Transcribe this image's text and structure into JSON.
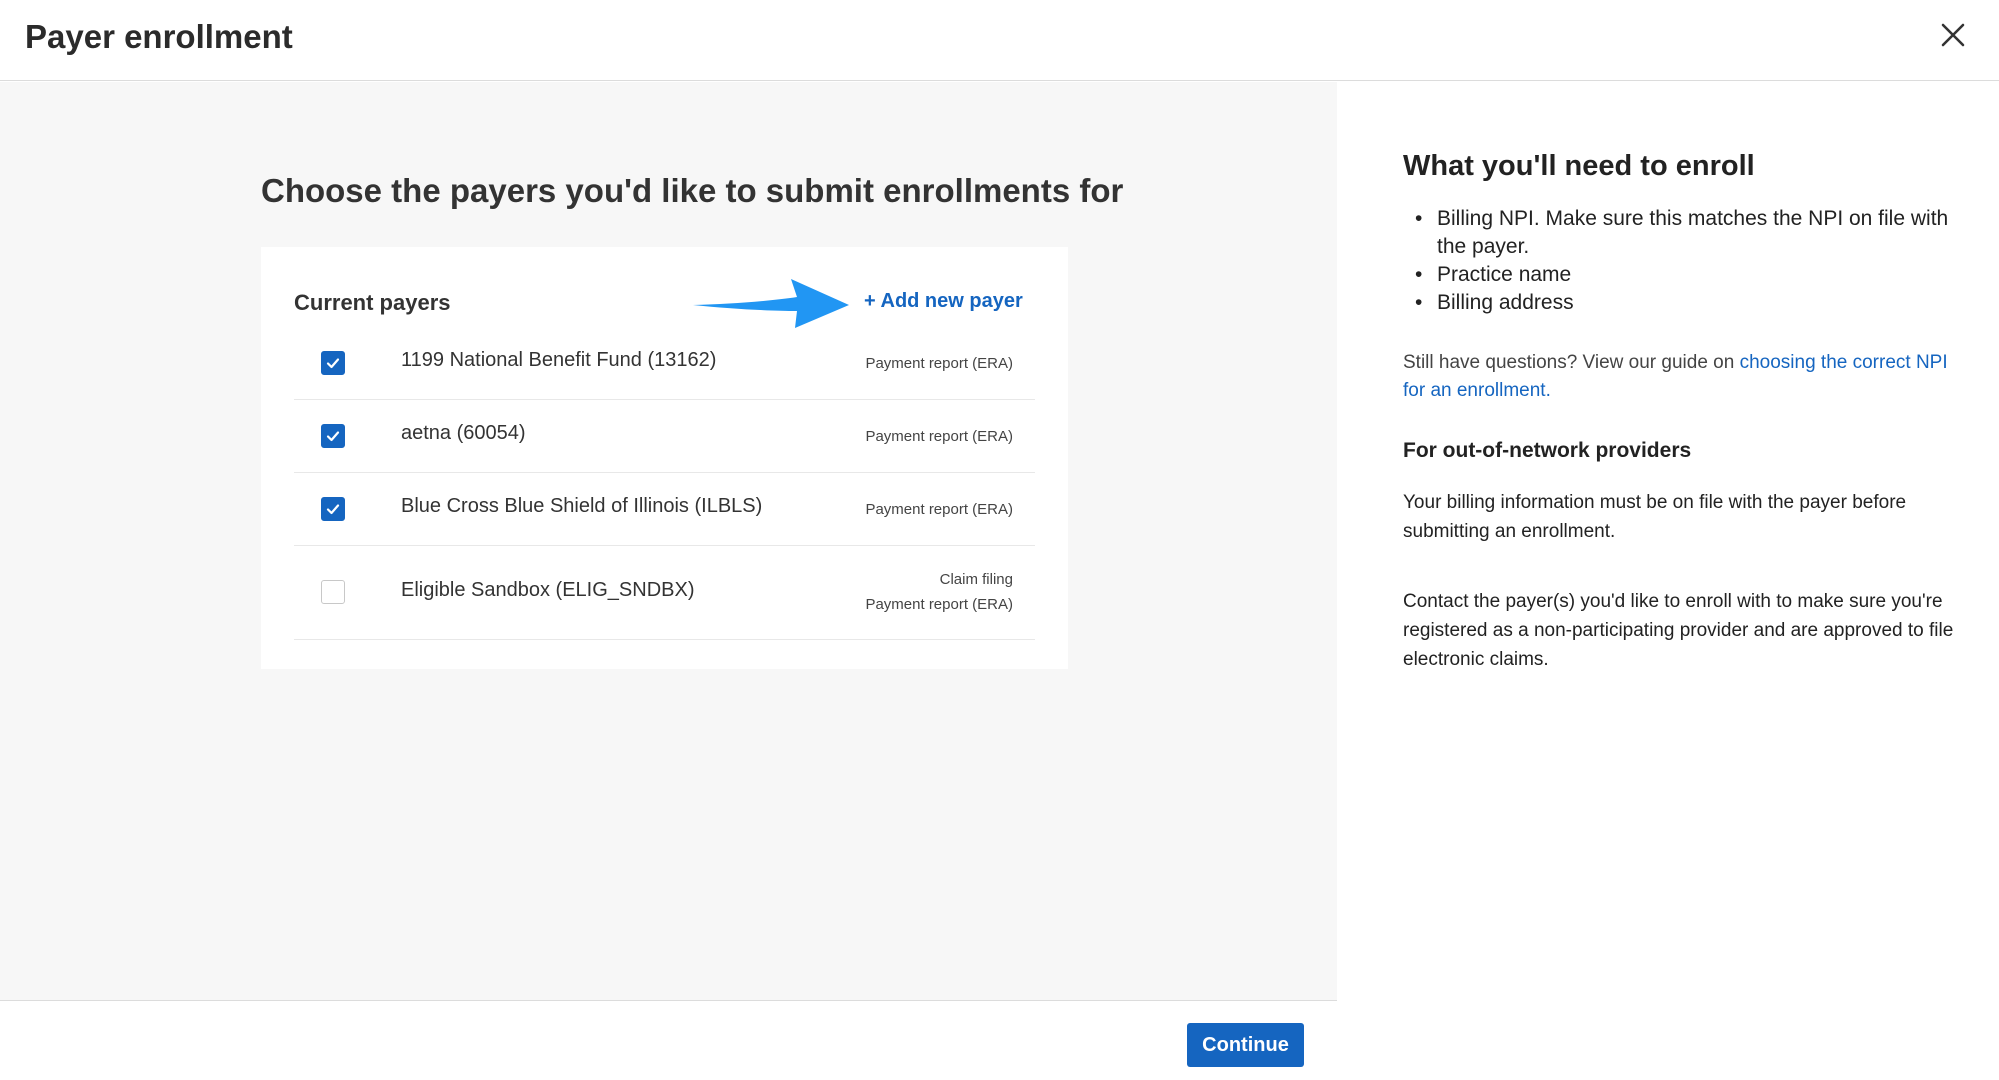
{
  "header": {
    "title": "Payer enrollment"
  },
  "main": {
    "heading": "Choose the payers you'd like to submit enrollments for",
    "card": {
      "title": "Current payers",
      "add_link": "+ Add new payer",
      "payers": [
        {
          "name": "1199 National Benefit Fund (13162)",
          "checked": true,
          "services": [
            "Payment report (ERA)"
          ]
        },
        {
          "name": "aetna (60054)",
          "checked": true,
          "services": [
            "Payment report (ERA)"
          ]
        },
        {
          "name": "Blue Cross Blue Shield of Illinois (ILBLS)",
          "checked": true,
          "services": [
            "Payment report (ERA)"
          ]
        },
        {
          "name": "Eligible Sandbox (ELIG_SNDBX)",
          "checked": false,
          "services": [
            "Claim filing",
            "Payment report (ERA)"
          ]
        }
      ]
    }
  },
  "footer": {
    "continue_label": "Continue"
  },
  "sidebar": {
    "heading": "What you'll need to enroll",
    "requirements": [
      "Billing NPI. Make sure this matches the NPI on file with the payer.",
      "Practice name",
      "Billing address"
    ],
    "question_text": "Still have questions? View our guide on ",
    "question_link": "choosing the correct NPI for an enrollment.",
    "oon_heading": "For out-of-network providers",
    "oon_para1": "Your billing information must be on file with the payer before submitting an enrollment.",
    "oon_para2": "Contact the payer(s) you'd like to enroll with to make sure you're registered as a non-participating provider and are approved to file electronic claims."
  },
  "colors": {
    "accent": "#1565c0",
    "arrow": "#2196f3",
    "left_bg": "#f7f7f7"
  },
  "icons": {
    "close": "close-icon",
    "check": "checkmark-icon",
    "arrow": "arrow-right-icon"
  }
}
